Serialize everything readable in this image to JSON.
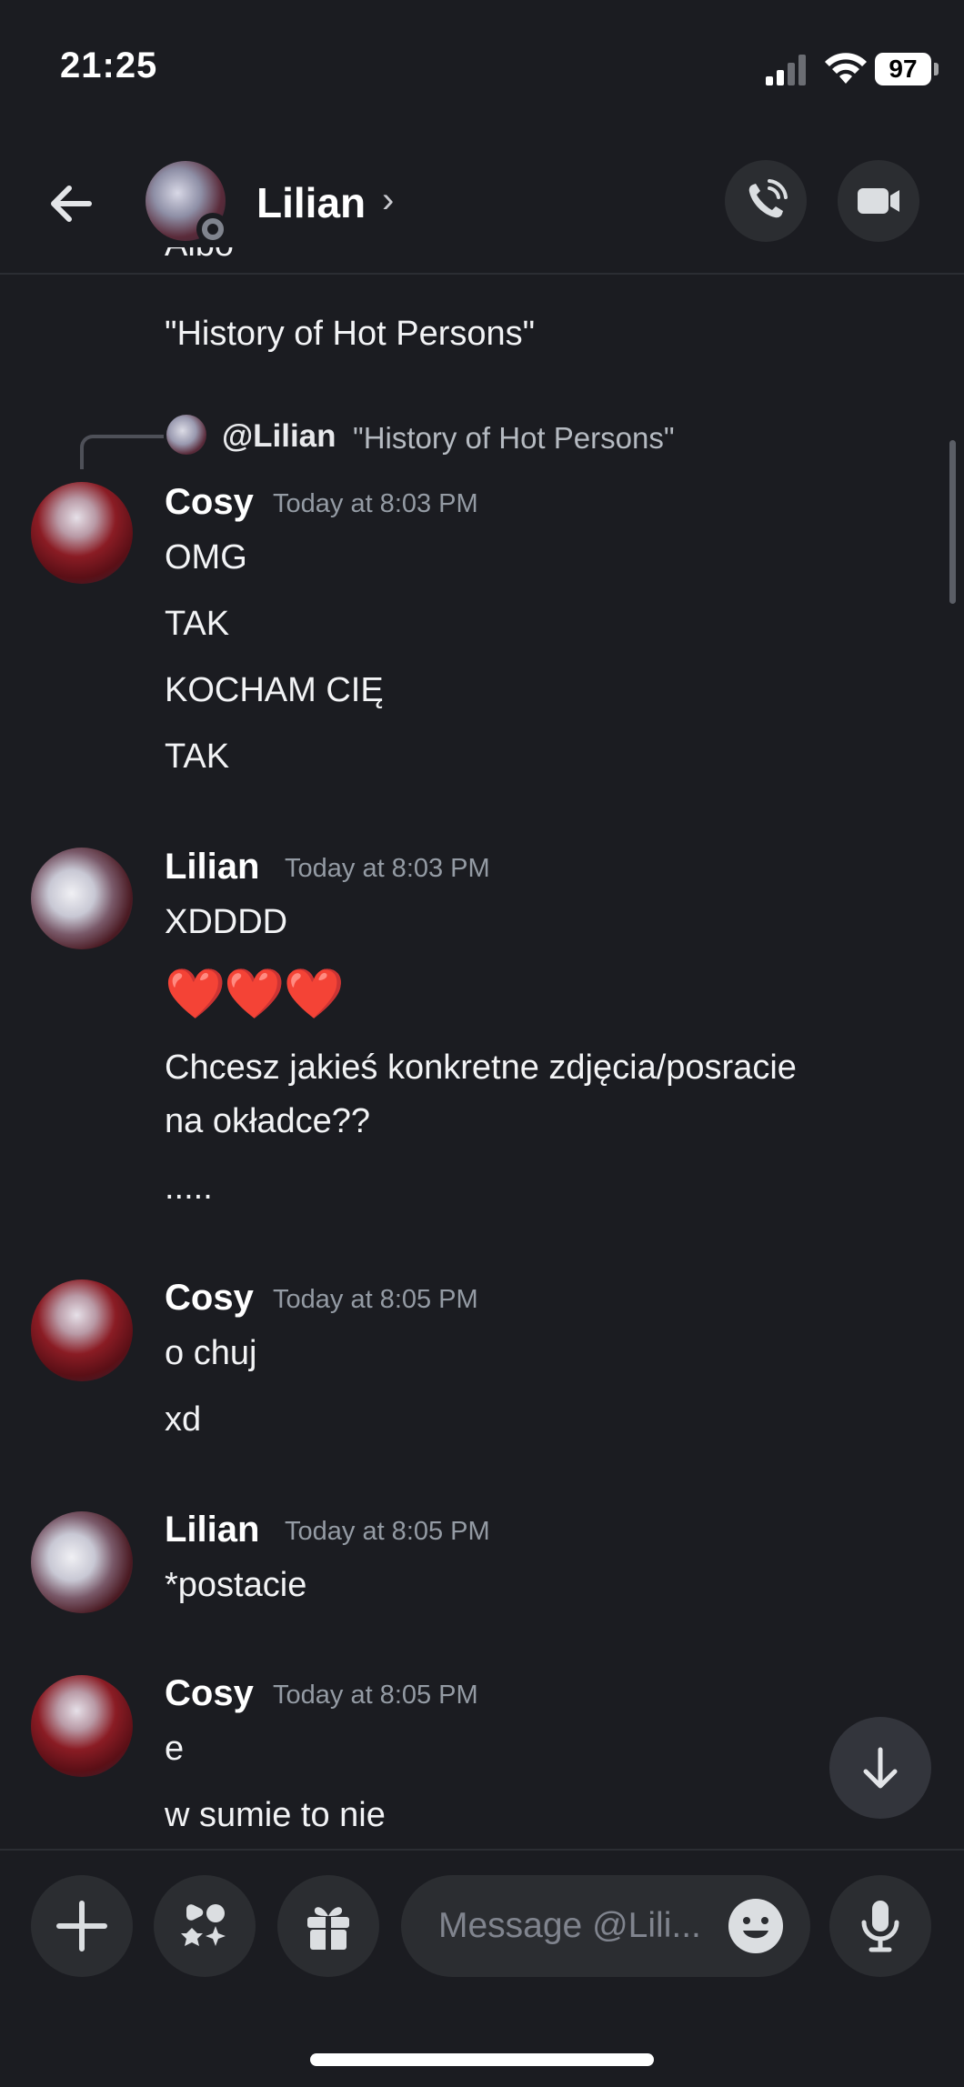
{
  "status_bar": {
    "time": "21:25",
    "battery": "97"
  },
  "header": {
    "name": "Lilian",
    "chevron": "›"
  },
  "top_partial": {
    "cut_text": "Albo",
    "quote": "\"History of Hot Persons\""
  },
  "reply": {
    "mention": "@Lilian",
    "text": "\"History of Hot Persons\""
  },
  "messages": [
    {
      "name": "Cosy",
      "time": "Today at 8:03 PM",
      "lines": [
        "OMG",
        "TAK",
        "KOCHAM CIĘ",
        "TAK"
      ]
    },
    {
      "name": "Lilian",
      "time": "Today at 8:03 PM",
      "lines": [
        "XDDDD",
        "❤️❤️❤️",
        "Chcesz jakieś konkretne zdjęcia/posracie",
        "na okładce??",
        "....."
      ]
    },
    {
      "name": "Cosy",
      "time": "Today at 8:05 PM",
      "lines": [
        "o chuj",
        "xd"
      ]
    },
    {
      "name": "Lilian",
      "time": "Today at 8:05 PM",
      "lines": [
        "*postacie"
      ]
    },
    {
      "name": "Cosy",
      "time": "Today at 8:05 PM",
      "lines": [
        "e",
        "w sumie to nie"
      ]
    }
  ],
  "composer": {
    "placeholder": "Message @Lili..."
  },
  "icons": {
    "back": "arrow-left-icon",
    "call": "phone-icon",
    "video": "video-camera-icon",
    "plus": "plus-icon",
    "apps": "apps-icon",
    "gift": "gift-icon",
    "emoji": "emoji-icon",
    "mic": "microphone-icon",
    "jump": "arrow-down-icon"
  },
  "colors": {
    "background": "#1b1c21",
    "surface": "#2b2d31",
    "muted": "#949ba4",
    "heart": "#e0102a"
  }
}
